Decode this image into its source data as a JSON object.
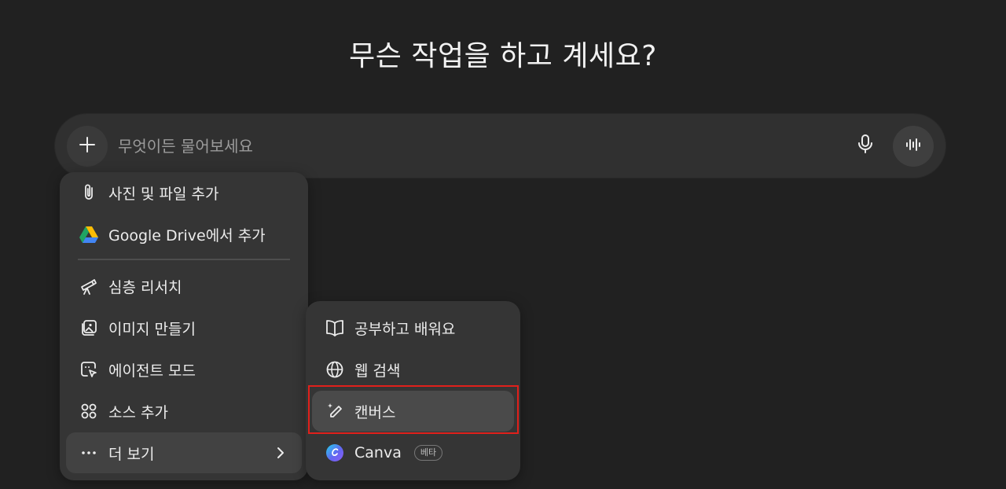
{
  "headline": "무슨 작업을 하고 계세요?",
  "composer": {
    "placeholder": "무엇이든 물어보세요",
    "value": ""
  },
  "menu": {
    "items": [
      {
        "label": "사진 및 파일 추가",
        "icon": "paperclip-icon"
      },
      {
        "label": "Google Drive에서 추가",
        "icon": "google-drive-icon"
      },
      {
        "label": "심층 리서치",
        "icon": "telescope-icon"
      },
      {
        "label": "이미지 만들기",
        "icon": "image-create-icon"
      },
      {
        "label": "에이전트 모드",
        "icon": "agent-cursor-icon"
      },
      {
        "label": "소스 추가",
        "icon": "sources-icon"
      },
      {
        "label": "더 보기",
        "icon": "more-dots-icon"
      }
    ]
  },
  "submenu": {
    "items": [
      {
        "label": "공부하고 배워요",
        "icon": "book-open-icon"
      },
      {
        "label": "웹 검색",
        "icon": "globe-icon"
      },
      {
        "label": "캔버스",
        "icon": "pen-sparkle-icon"
      },
      {
        "label": "Canva",
        "icon": "canva-logo-icon",
        "badge": "베타"
      }
    ]
  },
  "colors": {
    "background": "#212121",
    "composer": "#303030",
    "menu": "#353535",
    "highlight": "#e0201b"
  }
}
